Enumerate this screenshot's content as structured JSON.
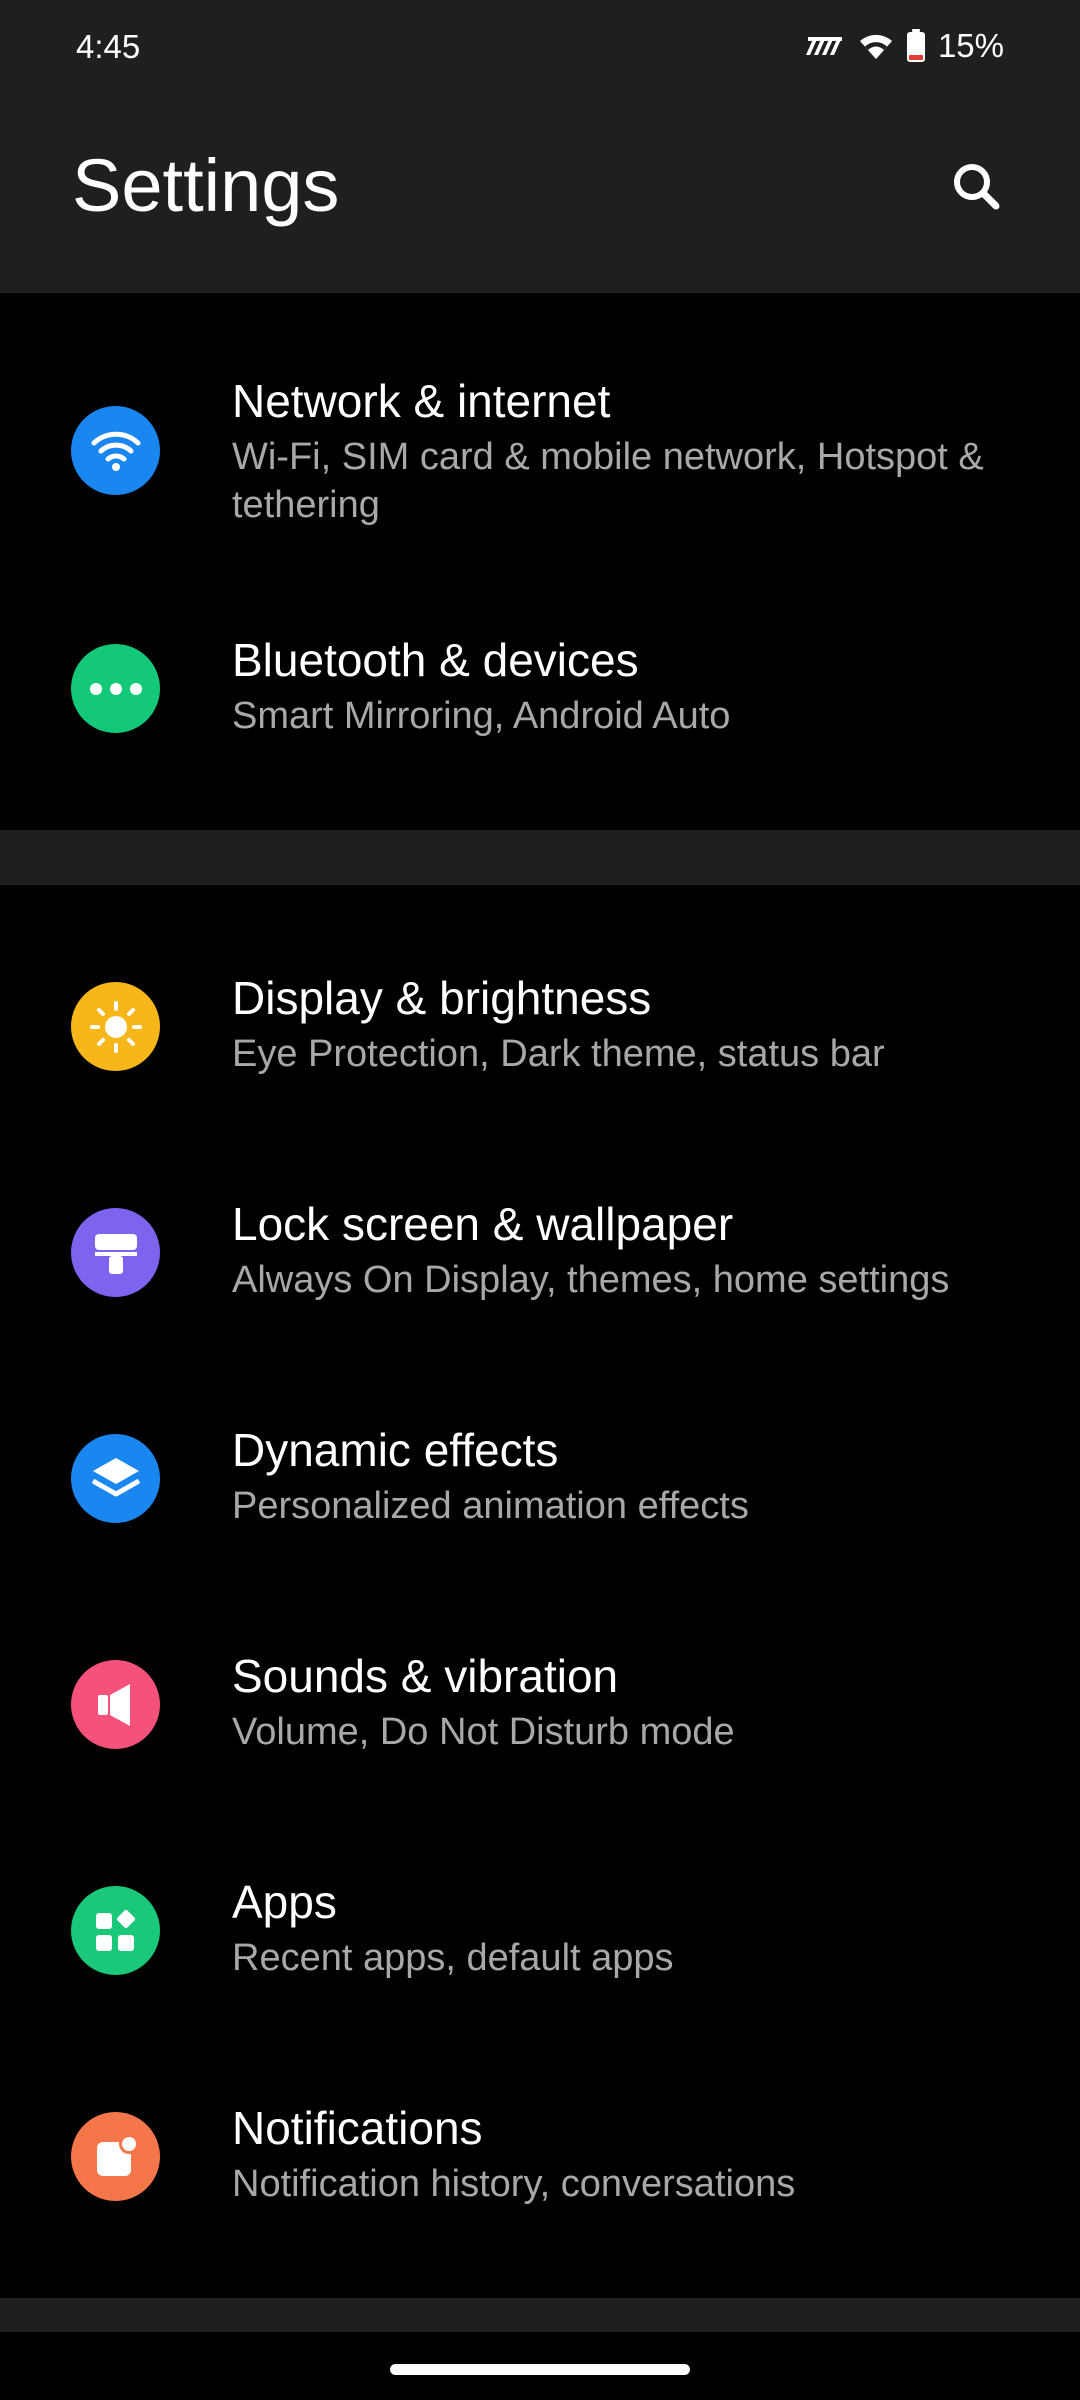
{
  "status_bar": {
    "time": "4:45",
    "battery_percent": "15%",
    "battery_level": 0.15,
    "icons": [
      "signal-icon",
      "wifi-icon",
      "battery-icon"
    ]
  },
  "header": {
    "title": "Settings",
    "search_icon": "search-icon"
  },
  "colors": {
    "background": "#000000",
    "header_bg": "#1f1f1f",
    "subtitle": "#a8a8a8",
    "network_icon": "#1a86f0",
    "bluetooth_icon": "#13c979",
    "display_icon": "#f7b71a",
    "lock_icon": "#7e63ee",
    "dynamic_icon": "#1a86f0",
    "sounds_icon": "#f4517b",
    "apps_icon": "#19c878",
    "notifications_icon": "#f5764a",
    "battery_low": "#e53935"
  },
  "settings": {
    "network": {
      "title": "Network & internet",
      "subtitle": "Wi-Fi, SIM card & mobile network, Hotspot & tethering",
      "icon": "wifi-icon"
    },
    "bluetooth": {
      "title": "Bluetooth & devices",
      "subtitle": "Smart Mirroring, Android Auto",
      "icon": "more-dots-icon"
    },
    "display": {
      "title": "Display & brightness",
      "subtitle": "Eye Protection, Dark theme, status bar",
      "icon": "sun-icon"
    },
    "lock_screen": {
      "title": "Lock screen & wallpaper",
      "subtitle": "Always On Display, themes, home settings",
      "icon": "paint-roller-icon"
    },
    "dynamic_effects": {
      "title": "Dynamic effects",
      "subtitle": "Personalized animation effects",
      "icon": "layers-icon"
    },
    "sounds": {
      "title": "Sounds & vibration",
      "subtitle": "Volume, Do Not Disturb mode",
      "icon": "speaker-icon"
    },
    "apps": {
      "title": "Apps",
      "subtitle": "Recent apps, default apps",
      "icon": "apps-grid-icon"
    },
    "notifications": {
      "title": "Notifications",
      "subtitle": "Notification history, conversations",
      "icon": "notification-badge-icon"
    }
  }
}
